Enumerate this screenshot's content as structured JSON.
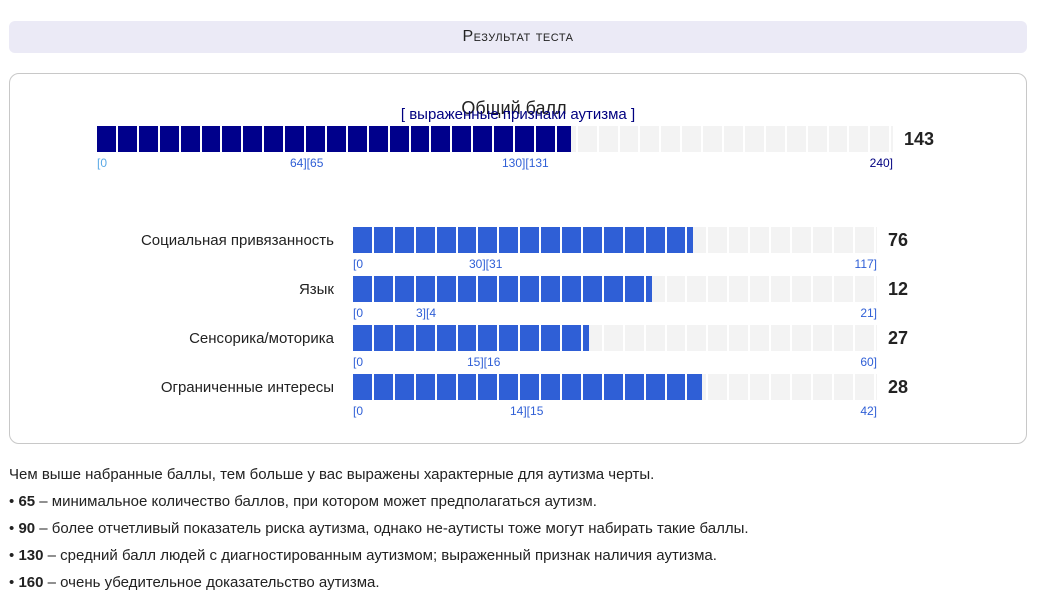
{
  "header": {
    "title": "Результат теста"
  },
  "total": {
    "title": "Общий балл",
    "value": "143",
    "score": 143,
    "max": 240,
    "ticks": [
      "[0",
      "64][65",
      "130][131",
      "240]"
    ],
    "range_label": "[ выраженные признаки аутизма ]"
  },
  "subscales": [
    {
      "label": "Социальная привязанность",
      "value": "76",
      "score": 76,
      "max": 117,
      "ticks": [
        "[0",
        "30][31",
        "117]"
      ]
    },
    {
      "label": "Язык",
      "value": "12",
      "score": 12,
      "max": 21,
      "ticks": [
        "[0",
        "3][4",
        "21]"
      ]
    },
    {
      "label": "Сенсорика/моторика",
      "value": "27",
      "score": 27,
      "max": 60,
      "ticks": [
        "[0",
        "15][16",
        "60]"
      ]
    },
    {
      "label": "Ограниченные интересы",
      "value": "28",
      "score": 28,
      "max": 42,
      "ticks": [
        "[0",
        "14][15",
        "42]"
      ]
    }
  ],
  "notes": {
    "intro": "Чем выше набранные баллы, тем больше у вас выражены характерные для аутизма черты.",
    "items": [
      {
        "bullet": "•",
        "num": "65",
        "text": " – минимальное количество баллов, при котором может предполагаться аутизм."
      },
      {
        "bullet": "•",
        "num": "90",
        "text": " – более отчетливый показатель риска аутизма, однако не-аутисты тоже могут набирать такие баллы."
      },
      {
        "bullet": "•",
        "num": "130",
        "text": " – средний балл людей с диагностированным аутизмом; выраженный признак наличия аутизма."
      },
      {
        "bullet": "•",
        "num": "160",
        "text": " – очень убедительное доказательство аутизма."
      }
    ]
  },
  "colors": {
    "total_fill": "#00008b",
    "sub_fill": "#2f5fd6",
    "tick_light": "#5aa9e6",
    "tick_mid": "#2f5fd6",
    "tick_dark": "#000080",
    "empty": "#f3f3f3"
  }
}
